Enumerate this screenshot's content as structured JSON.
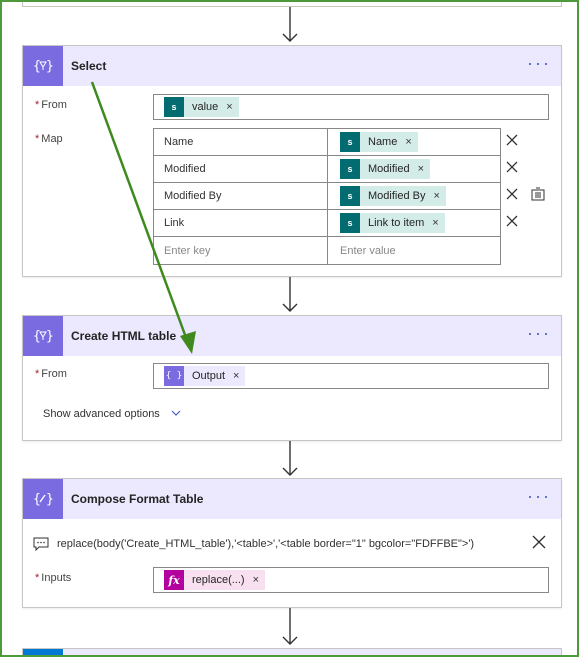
{
  "select": {
    "title": "Select",
    "more": "···",
    "from_label": "From",
    "map_label": "Map",
    "from_token": {
      "label": "value",
      "icon": "sharepoint-icon"
    },
    "map_rows": [
      {
        "key": "Name",
        "value": "Name"
      },
      {
        "key": "Modified",
        "value": "Modified"
      },
      {
        "key": "Modified By",
        "value": "Modified By"
      },
      {
        "key": "Link",
        "value": "Link to item"
      }
    ],
    "key_placeholder": "Enter key",
    "value_placeholder": "Enter value"
  },
  "html_table": {
    "title": "Create HTML table",
    "more": "···",
    "from_label": "From",
    "from_token": {
      "label": "Output",
      "icon": "variable-icon"
    },
    "advanced": "Show advanced options"
  },
  "compose": {
    "title": "Compose Format Table",
    "more": "···",
    "expression": "replace(body('Create_HTML_table'),'<table>','<table border=\"1\" bgcolor=\"FDFFBE\">')",
    "inputs_label": "Inputs",
    "inputs_token": {
      "label": "replace(...)",
      "icon": "fx-icon"
    }
  },
  "colors": {
    "card_icon": "#7a6be0",
    "header_bg": "#ece8fd",
    "sharepoint": "#036c70",
    "annotation_arrow": "#3f8a1e",
    "frame": "#4e9a3a"
  },
  "token_remove": "×",
  "sp_glyph": "s",
  "icon_glyph": "{ }"
}
